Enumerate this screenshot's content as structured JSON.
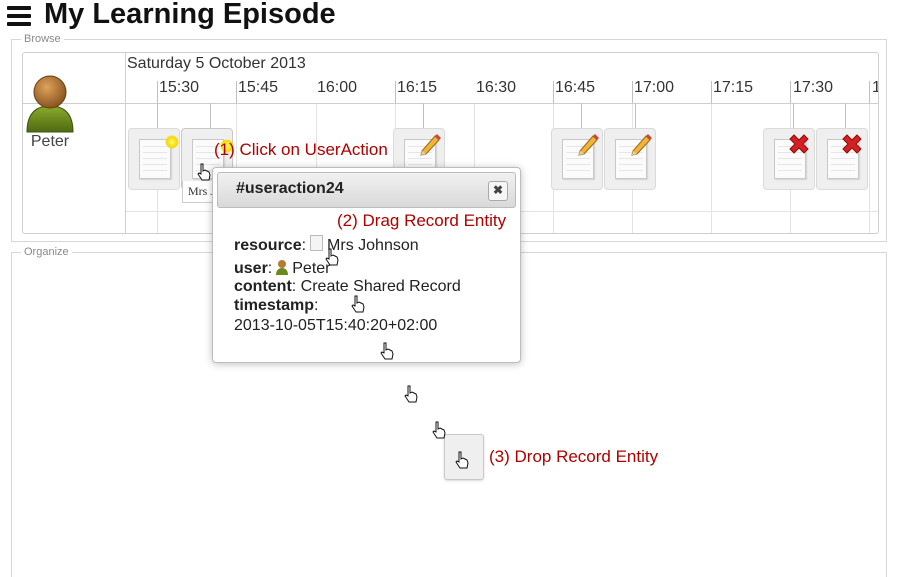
{
  "header": {
    "title": "My Learning Episode",
    "menu_icon": "hamburger-menu-icon"
  },
  "browse": {
    "legend": "Browse",
    "date": "Saturday 5 October 2013",
    "ticks": [
      "15:30",
      "15:45",
      "16:00",
      "16:15",
      "16:30",
      "16:45",
      "17:00",
      "17:15",
      "17:30",
      "1"
    ],
    "actor": {
      "name": "Peter",
      "icon": "user-avatar-icon"
    },
    "records": [
      {
        "badge": "glow",
        "note": "highlighted"
      },
      {
        "badge": "glow",
        "label": "Mrs J",
        "note": "clicked"
      },
      {
        "badge": "pencil-icon"
      },
      {
        "badge": "pencil-icon"
      },
      {
        "badge": "pencil-icon"
      },
      {
        "badge": "delete-x-icon"
      },
      {
        "badge": "delete-x-icon"
      }
    ]
  },
  "organize": {
    "legend": "Organize"
  },
  "popup": {
    "title": "#useraction24",
    "close_label": "✖",
    "fields": {
      "resource_label": "resource",
      "resource_value": "Mrs Johnson",
      "user_label": "user",
      "user_value": "Peter",
      "content_label": "content",
      "content_value": "Create Shared Record",
      "timestamp_label": "timestamp",
      "timestamp_value": "2013-10-05T15:40:20+02:00"
    }
  },
  "annotations": {
    "step1": "(1) Click on UserAction",
    "step2": "(2) Drag Record Entity",
    "step3": "(3) Drop Record Entity"
  },
  "colors": {
    "annotation": "#b00000",
    "avatar_body": "#6b8a1e",
    "avatar_head": "#b87a30",
    "delete": "#d42020",
    "glow": "#f4d800"
  }
}
